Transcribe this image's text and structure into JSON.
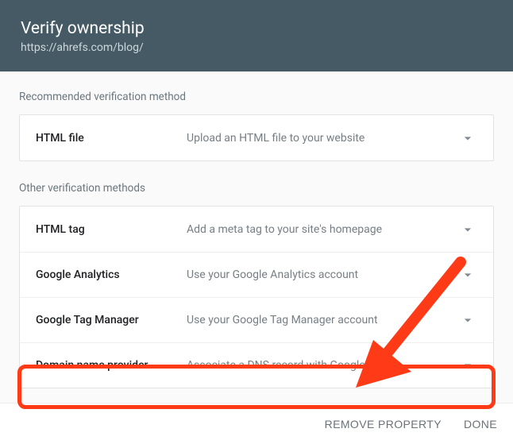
{
  "header": {
    "title": "Verify ownership",
    "subtitle": "https://ahrefs.com/blog/"
  },
  "sections": {
    "recommended_label": "Recommended verification method",
    "other_label": "Other verification methods"
  },
  "methods": {
    "recommended": {
      "title": "HTML file",
      "desc": "Upload an HTML file to your website"
    },
    "other": [
      {
        "title": "HTML tag",
        "desc": "Add a meta tag to your site's homepage"
      },
      {
        "title": "Google Analytics",
        "desc": "Use your Google Analytics account"
      },
      {
        "title": "Google Tag Manager",
        "desc": "Use your Google Tag Manager account"
      },
      {
        "title": "Domain name provider",
        "desc": "Associate a DNS record with Google"
      }
    ]
  },
  "footer": {
    "remove": "Remove property",
    "done": "Done"
  }
}
